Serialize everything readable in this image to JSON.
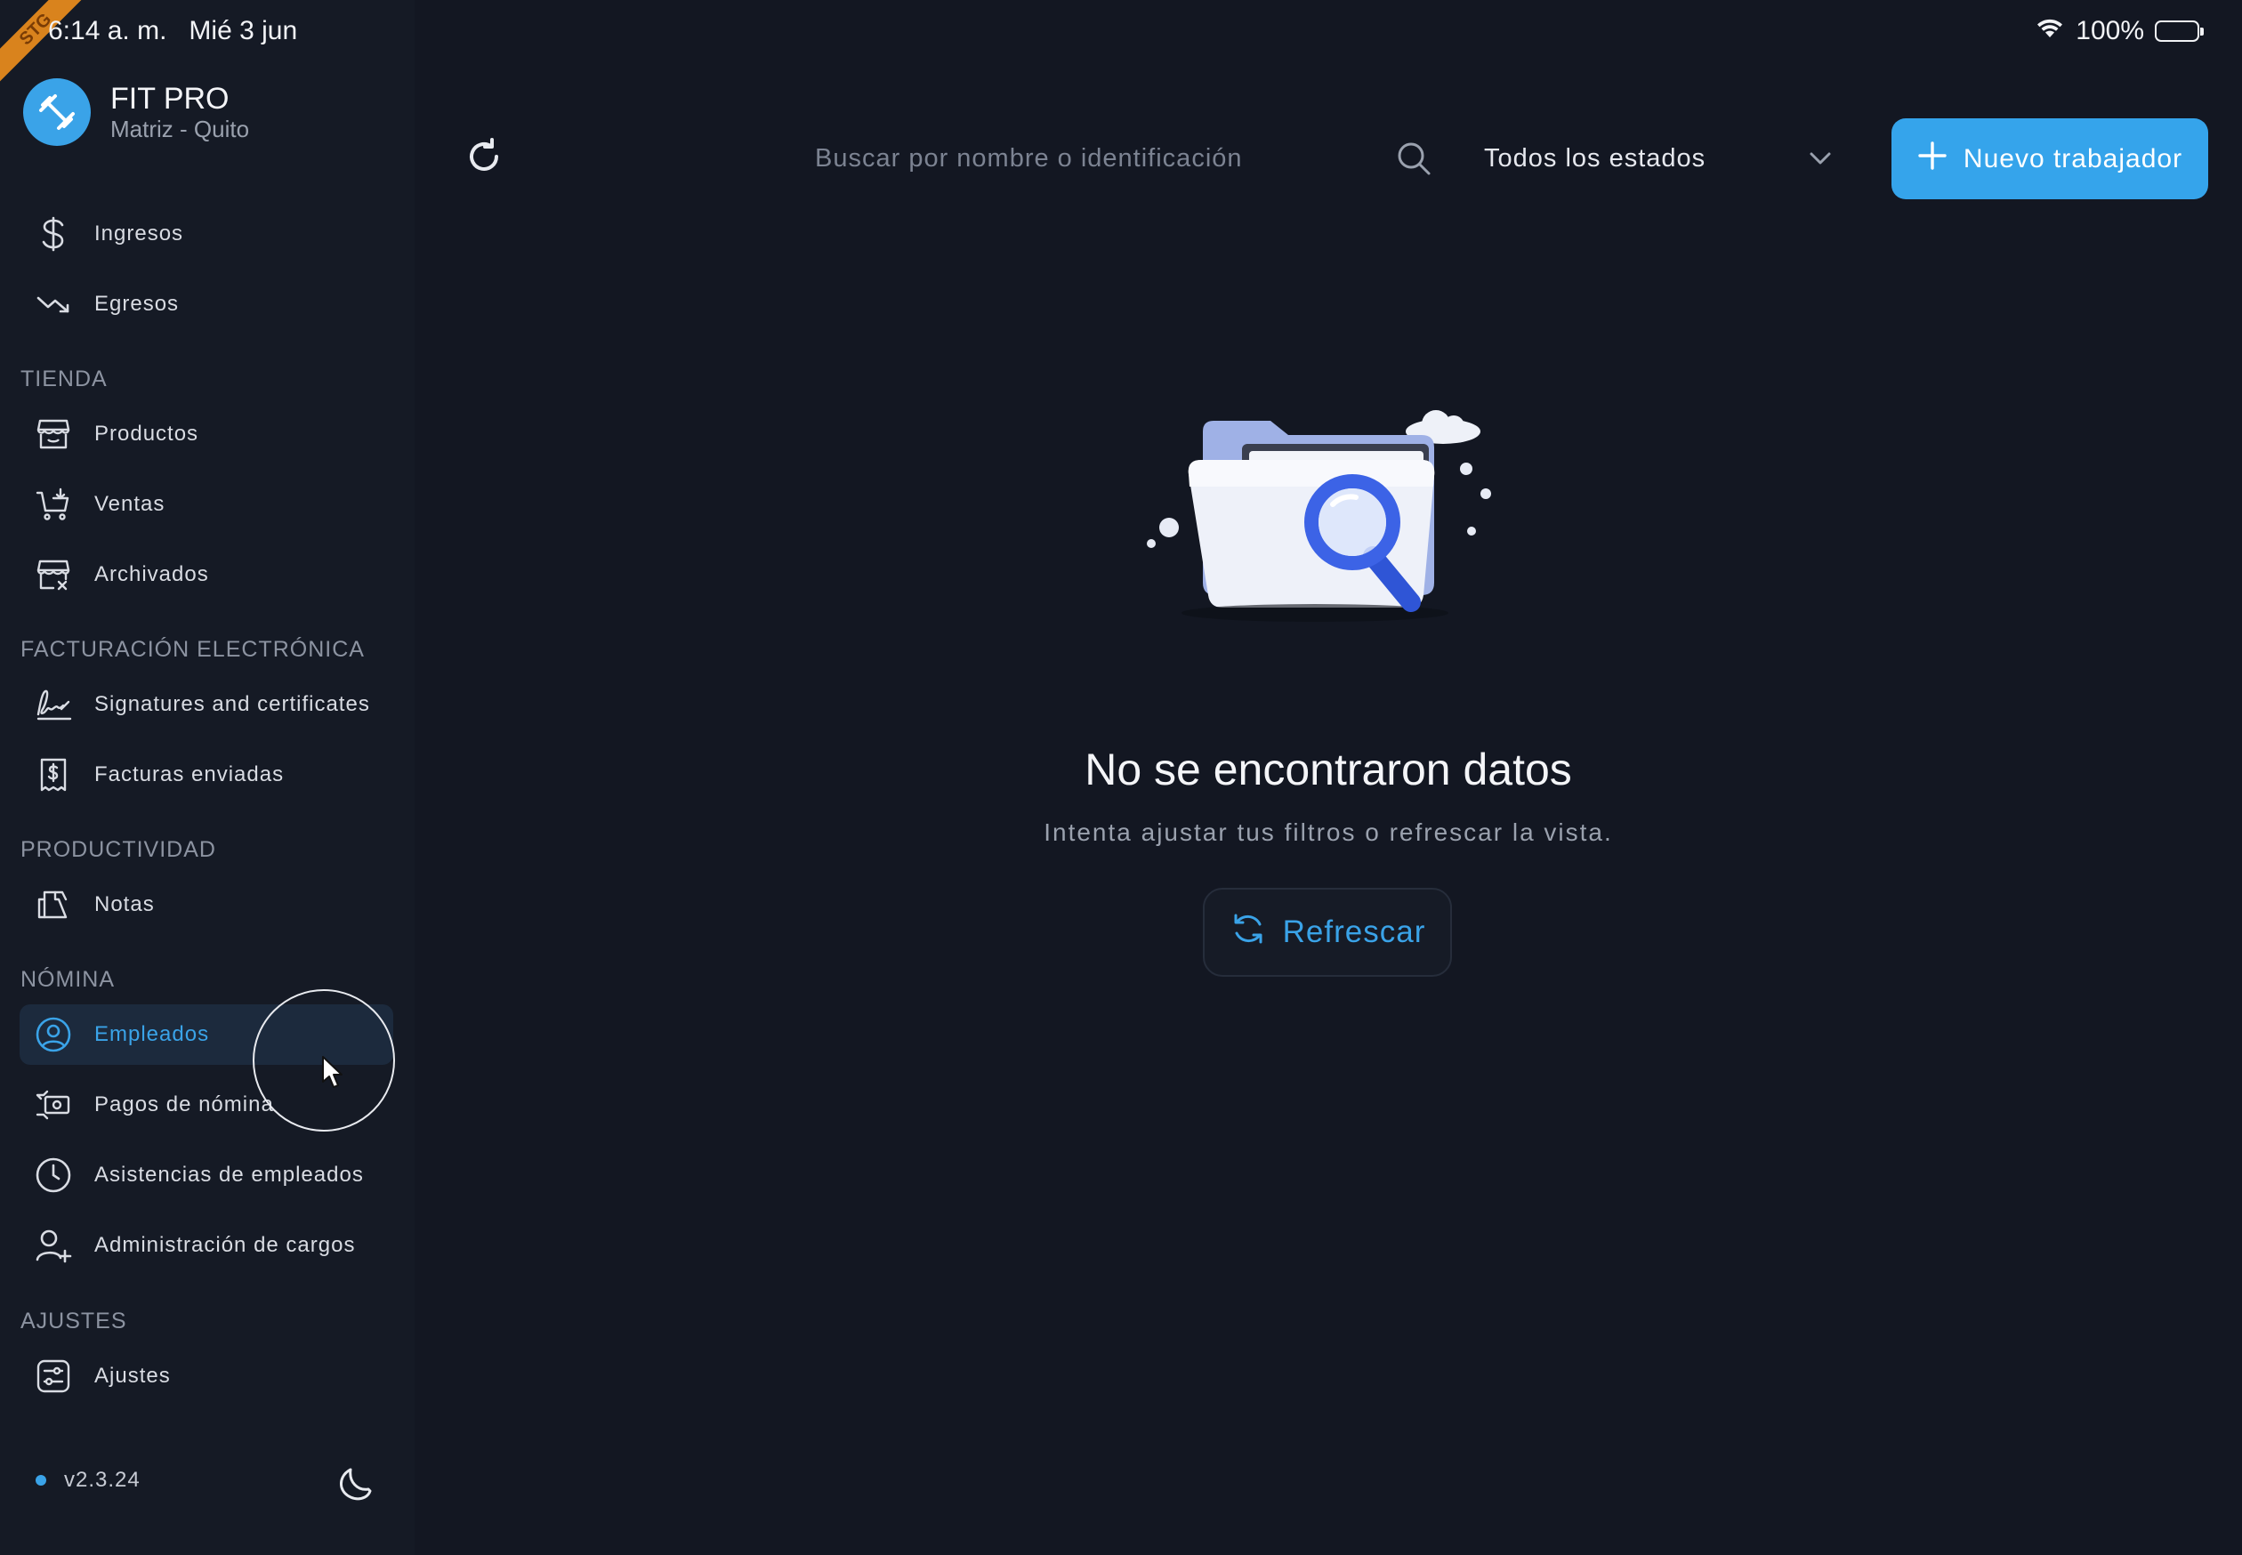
{
  "status_bar": {
    "time": "6:14 a. m.   Mié 3 jun",
    "battery": "100%",
    "ribbon": "STG"
  },
  "brand": {
    "name": "FIT PRO",
    "subtitle": "Matriz - Quito"
  },
  "nav": {
    "items_top": [
      {
        "label": "Ingresos",
        "icon": "dollar-icon"
      },
      {
        "label": "Egresos",
        "icon": "trending-down-icon"
      }
    ],
    "tienda": {
      "title": "TIENDA",
      "items": [
        {
          "label": "Productos",
          "icon": "store-icon"
        },
        {
          "label": "Ventas",
          "icon": "cart-icon"
        },
        {
          "label": "Archivados",
          "icon": "archived-store-icon"
        }
      ]
    },
    "facturacion": {
      "title": "FACTURACIÓN ELECTRÓNICA",
      "items": [
        {
          "label": "Signatures and certificates",
          "icon": "signature-icon"
        },
        {
          "label": "Facturas enviadas",
          "icon": "receipt-icon"
        }
      ]
    },
    "productividad": {
      "title": "PRODUCTIVIDAD",
      "items": [
        {
          "label": "Notas",
          "icon": "notes-icon"
        }
      ]
    },
    "nomina": {
      "title": "NÓMINA",
      "items": [
        {
          "label": "Empleados",
          "icon": "user-circle-icon",
          "active": true
        },
        {
          "label": "Pagos de nómina",
          "icon": "payment-icon"
        },
        {
          "label": "Asistencias de empleados",
          "icon": "clock-icon"
        },
        {
          "label": "Administración de cargos",
          "icon": "user-plus-icon"
        }
      ]
    },
    "ajustes": {
      "title": "AJUSTES",
      "items": [
        {
          "label": "Ajustes",
          "icon": "settings-sliders-icon"
        }
      ]
    }
  },
  "footer": {
    "version": "v2.3.24"
  },
  "toolbar": {
    "search_placeholder": "Buscar por nombre o identificación",
    "filter_value": "Todos los estados",
    "new_button": "Nuevo trabajador"
  },
  "empty_state": {
    "title": "No se encontraron datos",
    "subtitle": "Intenta ajustar tus filtros o refrescar la vista.",
    "button": "Refrescar"
  },
  "colors": {
    "accent": "#35a4eb",
    "background": "#131722",
    "sidebar": "#151a25"
  }
}
